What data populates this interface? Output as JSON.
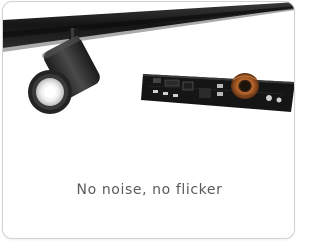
{
  "card": {
    "caption": "No noise, no flicker"
  },
  "image": {
    "subject": "product-photo",
    "colors": {
      "track": "#1c1c1c",
      "housing": "#2a2a2a",
      "lens_glow": "#f7f7f7",
      "pcb": "#1a1a1a",
      "coil": "#a0522d"
    }
  }
}
